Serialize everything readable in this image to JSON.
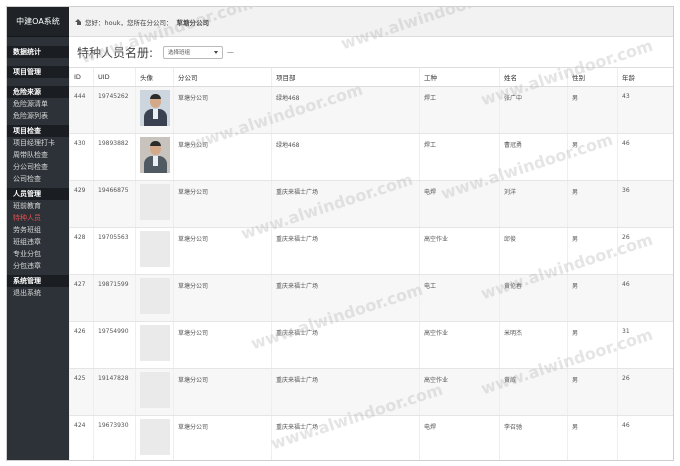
{
  "sidebar": {
    "brand": "中建OA系统",
    "items": [
      {
        "label": "数据统计",
        "type": "section"
      },
      {
        "label": "项目管理",
        "type": "section"
      },
      {
        "label": "危险来源",
        "type": "section"
      },
      {
        "label": "危险源清单",
        "type": "item"
      },
      {
        "label": "危险源列表",
        "type": "item"
      },
      {
        "label": "项目检查",
        "type": "section"
      },
      {
        "label": "项目经理打卡",
        "type": "item"
      },
      {
        "label": "周带队检查",
        "type": "item"
      },
      {
        "label": "分公司检查",
        "type": "item"
      },
      {
        "label": "公司检查",
        "type": "item"
      },
      {
        "label": "人员管理",
        "type": "section"
      },
      {
        "label": "班前教育",
        "type": "item"
      },
      {
        "label": "特种人员",
        "type": "item",
        "active": true
      },
      {
        "label": "劳务班组",
        "type": "item"
      },
      {
        "label": "班组违章",
        "type": "item"
      },
      {
        "label": "专业分包",
        "type": "item"
      },
      {
        "label": "分包违章",
        "type": "item"
      },
      {
        "label": "系统管理",
        "type": "section"
      },
      {
        "label": "退出系统",
        "type": "item"
      }
    ]
  },
  "topbar": {
    "greeting": "您好：houk，您所在分公司：",
    "company": "草塘分公司"
  },
  "page": {
    "title": "特种人员名册:",
    "select_value": "选择班组",
    "dash": "—"
  },
  "table": {
    "headers": [
      "ID",
      "UID",
      "头像",
      "分公司",
      "项目部",
      "工种",
      "姓名",
      "性别",
      "年龄"
    ],
    "rows": [
      {
        "id": "444",
        "uid": "19745262",
        "photo": "person-a",
        "branch": "草塘分公司",
        "project": "绿地468",
        "trade": "焊工",
        "name": "张广中",
        "gender": "男",
        "age": "43"
      },
      {
        "id": "430",
        "uid": "19893882",
        "photo": "person-b",
        "branch": "草塘分公司",
        "project": "绿地468",
        "trade": "焊工",
        "name": "曹冠勇",
        "gender": "男",
        "age": "46"
      },
      {
        "id": "429",
        "uid": "19466875",
        "photo": "",
        "branch": "草塘分公司",
        "project": "重庆来福士广场",
        "trade": "电焊",
        "name": "刘洋",
        "gender": "男",
        "age": "36"
      },
      {
        "id": "428",
        "uid": "19705563",
        "photo": "",
        "branch": "草塘分公司",
        "project": "重庆来福士广场",
        "trade": "高空作业",
        "name": "邱俊",
        "gender": "男",
        "age": "26"
      },
      {
        "id": "427",
        "uid": "19871599",
        "photo": "",
        "branch": "草塘分公司",
        "project": "重庆来福士广场",
        "trade": "电工",
        "name": "黄伦春",
        "gender": "男",
        "age": "46"
      },
      {
        "id": "426",
        "uid": "19754990",
        "photo": "",
        "branch": "草塘分公司",
        "project": "重庆来福士广场",
        "trade": "高空作业",
        "name": "米明杰",
        "gender": "男",
        "age": "31"
      },
      {
        "id": "425",
        "uid": "19147828",
        "photo": "",
        "branch": "草塘分公司",
        "project": "重庆来福士广场",
        "trade": "高空作业",
        "name": "黄威",
        "gender": "男",
        "age": "26"
      },
      {
        "id": "424",
        "uid": "19673930",
        "photo": "",
        "branch": "草塘分公司",
        "project": "重庆来福士广场",
        "trade": "电焊",
        "name": "李召驰",
        "gender": "男",
        "age": "46"
      }
    ]
  },
  "watermark": "www.alwindoor.com"
}
